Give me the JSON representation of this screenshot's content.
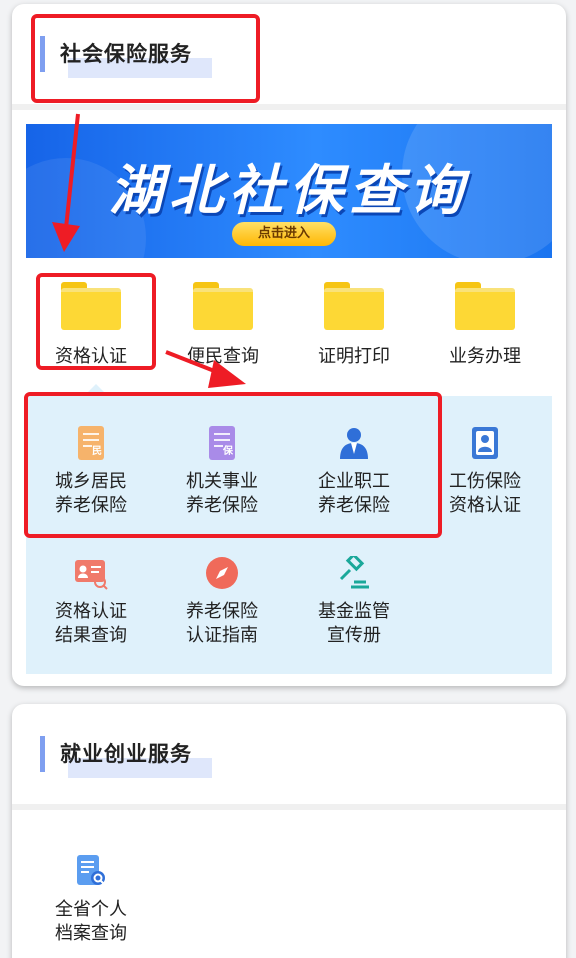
{
  "social_insurance": {
    "title": "社会保险服务",
    "banner": {
      "title": "湖北社保查询",
      "button": "点击进入"
    },
    "tabs": [
      {
        "label": "资格认证",
        "icon": "folder-icon"
      },
      {
        "label": "便民查询",
        "icon": "folder-icon"
      },
      {
        "label": "证明打印",
        "icon": "folder-icon"
      },
      {
        "label": "业务办理",
        "icon": "folder-icon"
      }
    ],
    "services": [
      {
        "line1": "城乡居民",
        "line2": "养老保险",
        "icon": "document-min-icon"
      },
      {
        "line1": "机关事业",
        "line2": "养老保险",
        "icon": "document-bao-icon"
      },
      {
        "line1": "企业职工",
        "line2": "养老保险",
        "icon": "worker-icon"
      },
      {
        "line1": "工伤保险",
        "line2": "资格认证",
        "icon": "id-card-icon"
      },
      {
        "line1": "资格认证",
        "line2": "结果查询",
        "icon": "card-search-icon"
      },
      {
        "line1": "养老保险",
        "line2": "认证指南",
        "icon": "compass-icon"
      },
      {
        "line1": "基金监管",
        "line2": "宣传册",
        "icon": "gavel-icon"
      }
    ]
  },
  "employment": {
    "title": "就业创业服务",
    "services": [
      {
        "line1": "全省个人",
        "line2": "档案查询",
        "icon": "file-search-icon"
      }
    ]
  },
  "colors": {
    "annotation_red": "#ee1c25",
    "banner_blue": "#1a6ff0",
    "folder_yellow": "#fdd835",
    "panel_bg": "#dff1fb"
  }
}
